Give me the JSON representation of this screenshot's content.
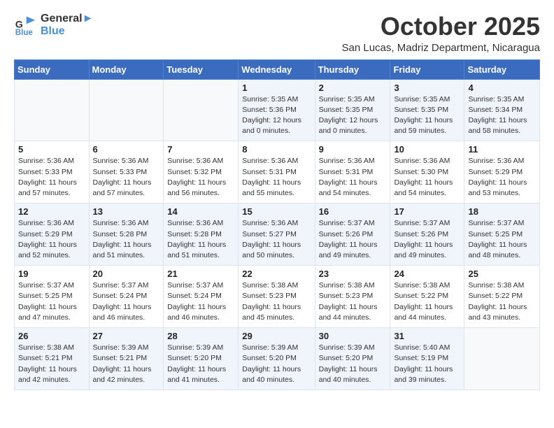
{
  "logo": {
    "line1": "General",
    "line2": "Blue"
  },
  "title": "October 2025",
  "subtitle": "San Lucas, Madriz Department, Nicaragua",
  "days_header": [
    "Sunday",
    "Monday",
    "Tuesday",
    "Wednesday",
    "Thursday",
    "Friday",
    "Saturday"
  ],
  "weeks": [
    [
      {
        "day": "",
        "info": ""
      },
      {
        "day": "",
        "info": ""
      },
      {
        "day": "",
        "info": ""
      },
      {
        "day": "1",
        "info": "Sunrise: 5:35 AM\nSunset: 5:36 PM\nDaylight: 12 hours\nand 0 minutes."
      },
      {
        "day": "2",
        "info": "Sunrise: 5:35 AM\nSunset: 5:35 PM\nDaylight: 12 hours\nand 0 minutes."
      },
      {
        "day": "3",
        "info": "Sunrise: 5:35 AM\nSunset: 5:35 PM\nDaylight: 11 hours\nand 59 minutes."
      },
      {
        "day": "4",
        "info": "Sunrise: 5:35 AM\nSunset: 5:34 PM\nDaylight: 11 hours\nand 58 minutes."
      }
    ],
    [
      {
        "day": "5",
        "info": "Sunrise: 5:36 AM\nSunset: 5:33 PM\nDaylight: 11 hours\nand 57 minutes."
      },
      {
        "day": "6",
        "info": "Sunrise: 5:36 AM\nSunset: 5:33 PM\nDaylight: 11 hours\nand 57 minutes."
      },
      {
        "day": "7",
        "info": "Sunrise: 5:36 AM\nSunset: 5:32 PM\nDaylight: 11 hours\nand 56 minutes."
      },
      {
        "day": "8",
        "info": "Sunrise: 5:36 AM\nSunset: 5:31 PM\nDaylight: 11 hours\nand 55 minutes."
      },
      {
        "day": "9",
        "info": "Sunrise: 5:36 AM\nSunset: 5:31 PM\nDaylight: 11 hours\nand 54 minutes."
      },
      {
        "day": "10",
        "info": "Sunrise: 5:36 AM\nSunset: 5:30 PM\nDaylight: 11 hours\nand 54 minutes."
      },
      {
        "day": "11",
        "info": "Sunrise: 5:36 AM\nSunset: 5:29 PM\nDaylight: 11 hours\nand 53 minutes."
      }
    ],
    [
      {
        "day": "12",
        "info": "Sunrise: 5:36 AM\nSunset: 5:29 PM\nDaylight: 11 hours\nand 52 minutes."
      },
      {
        "day": "13",
        "info": "Sunrise: 5:36 AM\nSunset: 5:28 PM\nDaylight: 11 hours\nand 51 minutes."
      },
      {
        "day": "14",
        "info": "Sunrise: 5:36 AM\nSunset: 5:28 PM\nDaylight: 11 hours\nand 51 minutes."
      },
      {
        "day": "15",
        "info": "Sunrise: 5:36 AM\nSunset: 5:27 PM\nDaylight: 11 hours\nand 50 minutes."
      },
      {
        "day": "16",
        "info": "Sunrise: 5:37 AM\nSunset: 5:26 PM\nDaylight: 11 hours\nand 49 minutes."
      },
      {
        "day": "17",
        "info": "Sunrise: 5:37 AM\nSunset: 5:26 PM\nDaylight: 11 hours\nand 49 minutes."
      },
      {
        "day": "18",
        "info": "Sunrise: 5:37 AM\nSunset: 5:25 PM\nDaylight: 11 hours\nand 48 minutes."
      }
    ],
    [
      {
        "day": "19",
        "info": "Sunrise: 5:37 AM\nSunset: 5:25 PM\nDaylight: 11 hours\nand 47 minutes."
      },
      {
        "day": "20",
        "info": "Sunrise: 5:37 AM\nSunset: 5:24 PM\nDaylight: 11 hours\nand 46 minutes."
      },
      {
        "day": "21",
        "info": "Sunrise: 5:37 AM\nSunset: 5:24 PM\nDaylight: 11 hours\nand 46 minutes."
      },
      {
        "day": "22",
        "info": "Sunrise: 5:38 AM\nSunset: 5:23 PM\nDaylight: 11 hours\nand 45 minutes."
      },
      {
        "day": "23",
        "info": "Sunrise: 5:38 AM\nSunset: 5:23 PM\nDaylight: 11 hours\nand 44 minutes."
      },
      {
        "day": "24",
        "info": "Sunrise: 5:38 AM\nSunset: 5:22 PM\nDaylight: 11 hours\nand 44 minutes."
      },
      {
        "day": "25",
        "info": "Sunrise: 5:38 AM\nSunset: 5:22 PM\nDaylight: 11 hours\nand 43 minutes."
      }
    ],
    [
      {
        "day": "26",
        "info": "Sunrise: 5:38 AM\nSunset: 5:21 PM\nDaylight: 11 hours\nand 42 minutes."
      },
      {
        "day": "27",
        "info": "Sunrise: 5:39 AM\nSunset: 5:21 PM\nDaylight: 11 hours\nand 42 minutes."
      },
      {
        "day": "28",
        "info": "Sunrise: 5:39 AM\nSunset: 5:20 PM\nDaylight: 11 hours\nand 41 minutes."
      },
      {
        "day": "29",
        "info": "Sunrise: 5:39 AM\nSunset: 5:20 PM\nDaylight: 11 hours\nand 40 minutes."
      },
      {
        "day": "30",
        "info": "Sunrise: 5:39 AM\nSunset: 5:20 PM\nDaylight: 11 hours\nand 40 minutes."
      },
      {
        "day": "31",
        "info": "Sunrise: 5:40 AM\nSunset: 5:19 PM\nDaylight: 11 hours\nand 39 minutes."
      },
      {
        "day": "",
        "info": ""
      }
    ]
  ]
}
